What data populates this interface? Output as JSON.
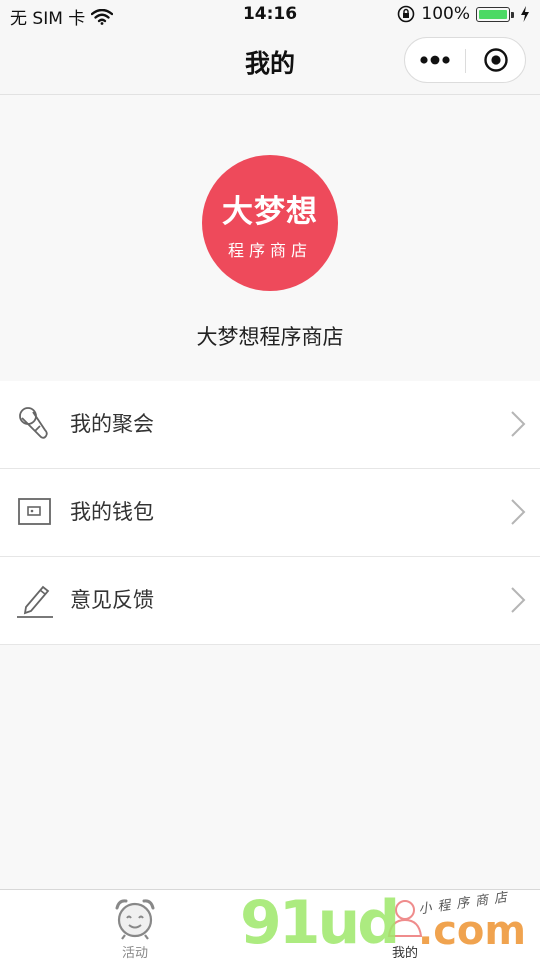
{
  "status_bar": {
    "carrier": "无 SIM 卡",
    "time": "14:16",
    "battery": "100%",
    "battery_level": 1.0,
    "icons": [
      "wifi-icon",
      "orientation-lock-icon",
      "battery-icon",
      "charging-icon"
    ]
  },
  "nav": {
    "title": "我的",
    "capsule_icons": [
      "more-dots-icon",
      "close-circle-icon"
    ]
  },
  "profile": {
    "logo_main": "大梦想",
    "logo_sub": "程序商店",
    "name": "大梦想程序商店",
    "logo_color": "#ee4a5b"
  },
  "menu": {
    "items": [
      {
        "label": "我的聚会",
        "icon": "microphone-icon"
      },
      {
        "label": "我的钱包",
        "icon": "wallet-icon"
      },
      {
        "label": "意见反馈",
        "icon": "pencil-icon"
      }
    ]
  },
  "tabbar": {
    "tabs": [
      {
        "label": "活动",
        "icon": "alarm-clock-icon"
      },
      {
        "label": "我的",
        "icon": "user-icon"
      }
    ]
  },
  "watermark": {
    "big": "91ud",
    "com": ".com",
    "small": "小程序商店"
  }
}
